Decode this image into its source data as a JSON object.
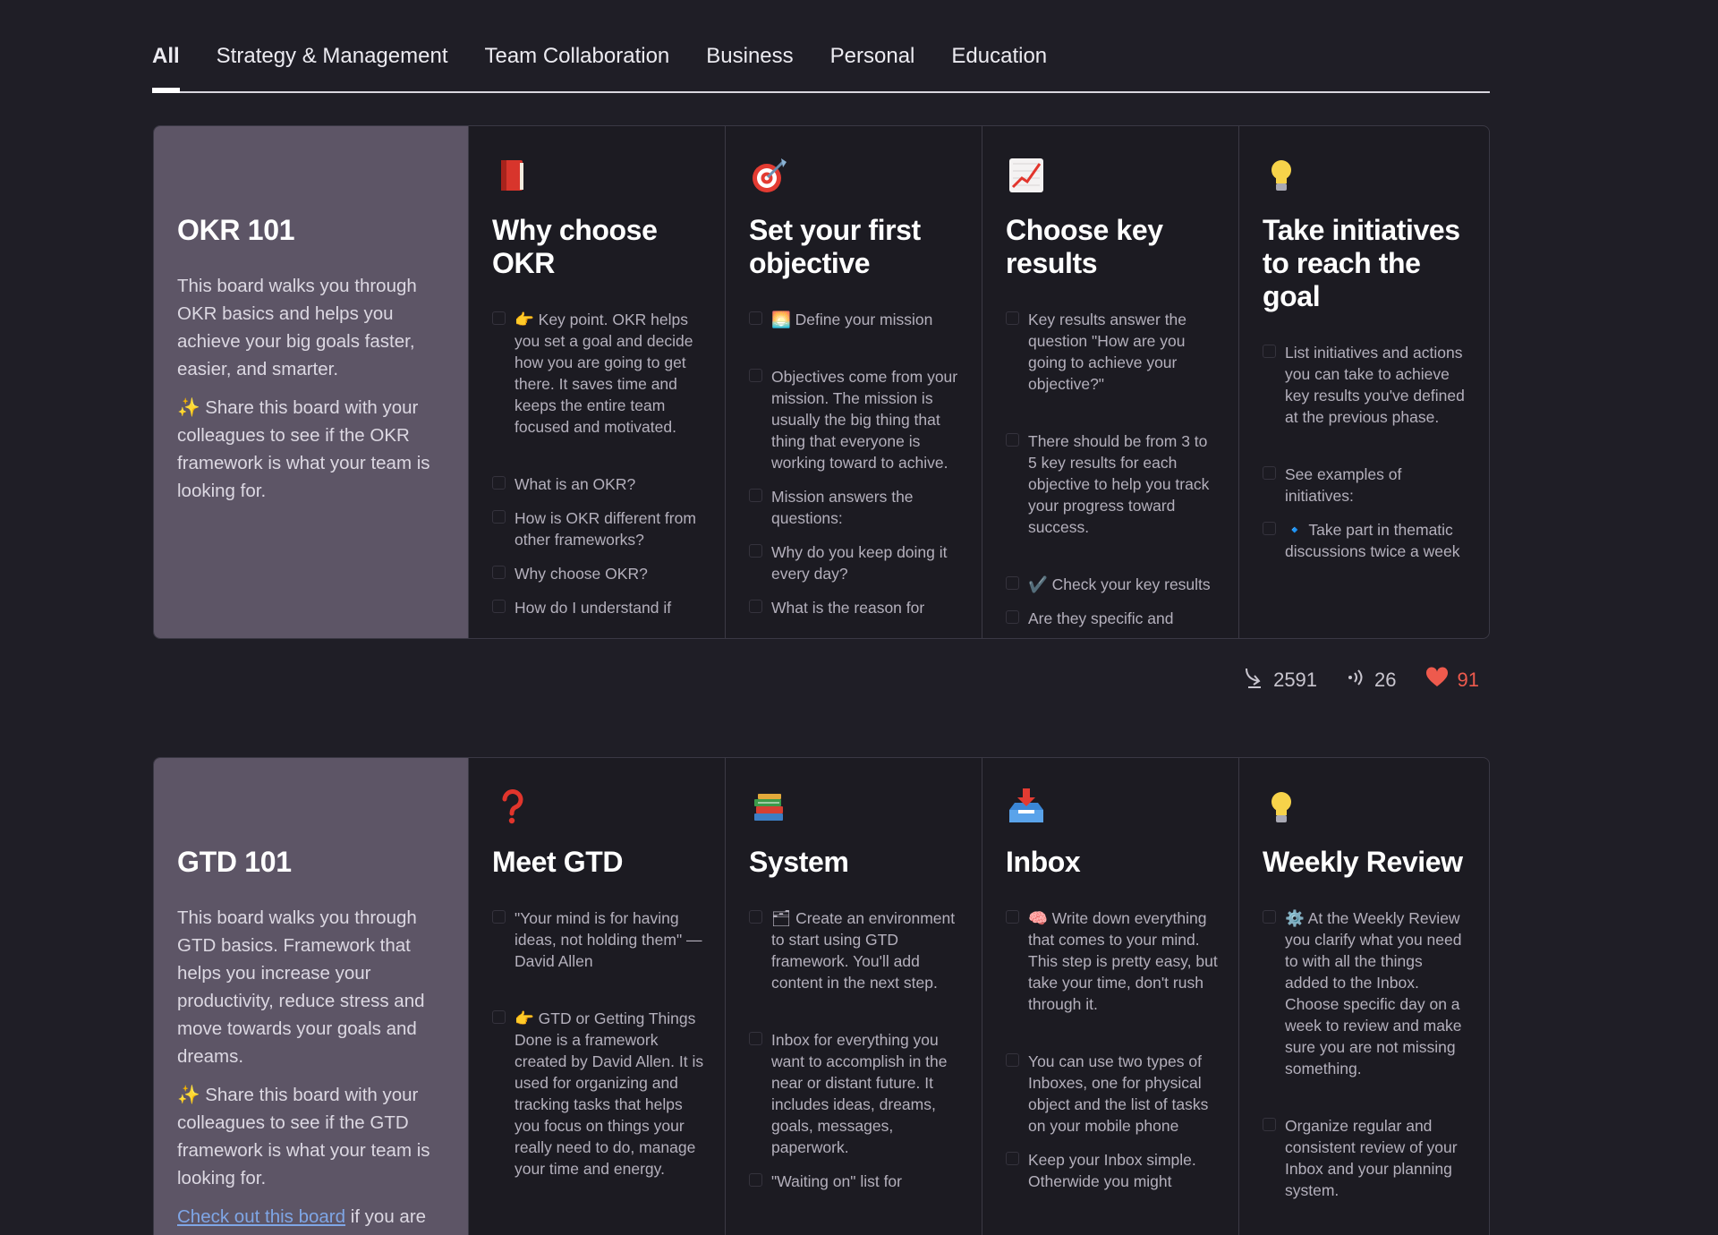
{
  "tabs": [
    {
      "label": "All",
      "active": true
    },
    {
      "label": "Strategy & Management",
      "active": false
    },
    {
      "label": "Team Collaboration",
      "active": false
    },
    {
      "label": "Business",
      "active": false
    },
    {
      "label": "Personal",
      "active": false
    },
    {
      "label": "Education",
      "active": false
    }
  ],
  "boards": [
    {
      "title": "OKR 101",
      "intro": [
        "This board walks you through OKR basics and helps you achieve your big goals faster, easier, and smarter.",
        "✨ Share this board with your colleagues to see if the OKR framework is what your team is looking for."
      ],
      "columns": [
        {
          "icon": "book-icon",
          "title": "Why choose OKR",
          "items": [
            "👉 Key point. OKR helps you set a goal and decide how you are going to get there. It saves time and keeps the entire team focused and motivated.",
            "What is an OKR?",
            "How is OKR different from other frameworks?",
            "Why choose OKR?",
            "How do I understand if"
          ]
        },
        {
          "icon": "target-icon",
          "title": "Set your first objective",
          "items": [
            "🌅 Define your mission",
            "Objectives come from your mission. The mission is usually the big thing that thing that everyone is working toward to achive.",
            "Mission answers the questions:",
            "Why do you keep doing it every day?",
            "What is the reason for"
          ]
        },
        {
          "icon": "chart-icon",
          "title": "Choose key results",
          "items": [
            "Key results answer the question \"How are you going to achieve your objective?\"",
            "There should be from 3 to 5 key results for each objective to help you track your progress toward success.",
            "✔️ Check your key results",
            "Are they specific and"
          ]
        },
        {
          "icon": "lightbulb-icon",
          "title": "Take initiatives to reach the goal",
          "items": [
            "List initiatives and actions you can take to achieve key results you've defined at the previous phase.",
            "See examples of initiatives:",
            "🔹 Take part in thematic discussions twice a week"
          ]
        }
      ],
      "stats": {
        "copies": "2591",
        "comments": "26",
        "likes": "91"
      }
    },
    {
      "title": "GTD 101",
      "intro": [
        "This board walks you through GTD basics. Framework that helps you increase your productivity, reduce stress and move towards your goals and dreams.",
        "✨ Share this board with your colleagues to see if the GTD framework is what your team is looking for."
      ],
      "link_text": "Check out this board",
      "link_suffix": " if you are",
      "columns": [
        {
          "icon": "question-icon",
          "title": "Meet GTD",
          "items": [
            "\"Your mind is for having ideas, not holding them\" — David Allen",
            "👉 GTD or Getting Things Done is a framework created by David Allen. It is used for organizing and tracking tasks that helps you focus on things your really need to do, manage your time and energy."
          ]
        },
        {
          "icon": "books-icon",
          "title": "System",
          "items": [
            "🗂 Create an environment to start using GTD framework. You'll add content in the next step.",
            "Inbox for everything you want to accomplish in the near or distant future. It includes ideas, dreams, goals, messages, paperwork.",
            "\"Waiting on\" list for"
          ]
        },
        {
          "icon": "inbox-icon",
          "title": "Inbox",
          "items": [
            "🧠 Write down everything that comes to your mind. This step is pretty easy, but take your time, don't rush through it.",
            "You can use two types of Inboxes, one for physical object and the list of tasks on your mobile phone",
            "Keep your Inbox simple. Otherwide you might"
          ]
        },
        {
          "icon": "lightbulb-icon",
          "title": "Weekly Review",
          "items": [
            "⚙️ At the Weekly Review you clarify what you need to with all the things added to the Inbox. Choose specific day on a week to review and make sure you are not missing something.",
            "Organize regular and consistent review of your Inbox and your planning system."
          ]
        }
      ]
    }
  ],
  "colors": {
    "background": "#1f1e26",
    "intro_panel": "#5d5566",
    "like": "#ee5a4d",
    "link": "#7fa6e6"
  }
}
